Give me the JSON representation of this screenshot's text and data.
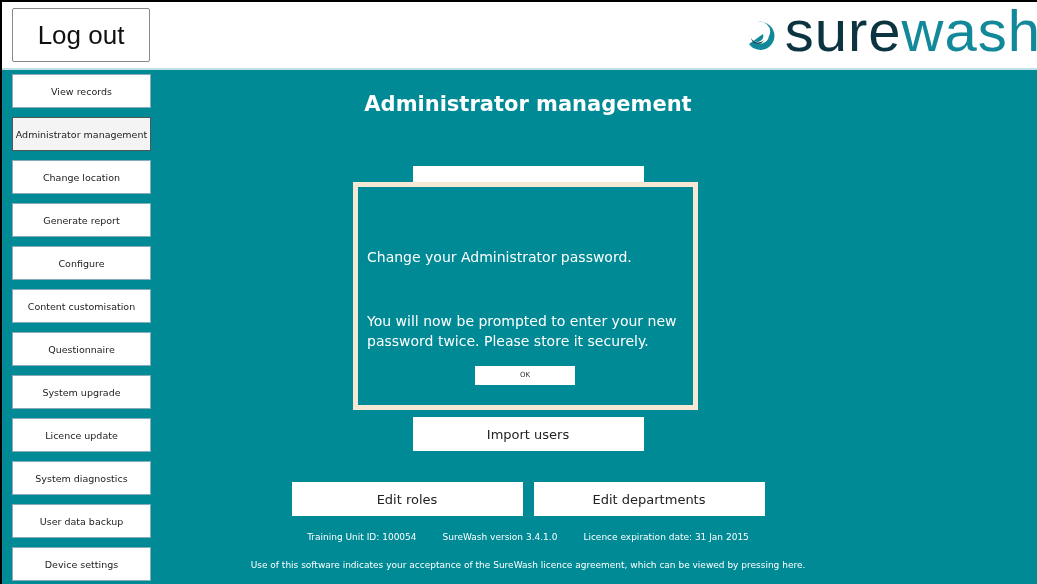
{
  "header": {
    "logout_button": "Log out",
    "logo": [
      {
        "text": "sure",
        "color": "#0b3440"
      },
      {
        "text": "wash",
        "color": "#12899a"
      }
    ]
  },
  "sidebar": {
    "items": [
      {
        "label": "View records",
        "selected": false
      },
      {
        "label": "Administrator management",
        "selected": true
      },
      {
        "label": "Change location",
        "selected": false
      },
      {
        "label": "Generate report",
        "selected": false
      },
      {
        "label": "Configure",
        "selected": false
      },
      {
        "label": "Content customisation",
        "selected": false
      },
      {
        "label": "Questionnaire",
        "selected": false
      },
      {
        "label": "System upgrade",
        "selected": false
      },
      {
        "label": "Licence update",
        "selected": false
      },
      {
        "label": "System diagnostics",
        "selected": false
      },
      {
        "label": "User data backup",
        "selected": false
      },
      {
        "label": "Device settings",
        "selected": false
      }
    ]
  },
  "main": {
    "title": "Administrator management",
    "buttons": [
      {
        "kind": "covered"
      },
      {
        "kind": "plain",
        "label": "Import users"
      }
    ],
    "button_row": [
      "Edit roles",
      "Edit departments"
    ],
    "info": [
      "Training Unit ID: 100054",
      "SureWash version 3.4.1.0",
      "Licence expiration date: 31 Jan 2015"
    ],
    "footer": "Use of this software indicates your acceptance of the SureWash licence agreement, which can be viewed by pressing here."
  },
  "dialog": {
    "message": "Change your Administrator password.",
    "detail": "You will now be prompted to enter your new password twice. Please store it securely.",
    "button": "OK"
  }
}
